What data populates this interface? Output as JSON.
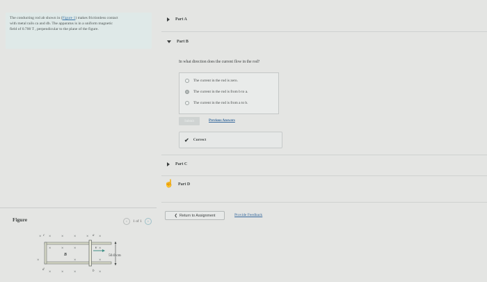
{
  "problem": {
    "line1": "The conducting rod ab shown in (",
    "figure_link": "Figure 1",
    "line1_end": ") makes frictionless contact",
    "line2": "with metal rails ca and db. The apparatus is in a uniform magnetic",
    "line3": "field of 0.700 T , perpendicular to the plane of the figure."
  },
  "figure_panel": {
    "title": "Figure",
    "pager": "1 of 1",
    "prev_arrow": "‹",
    "next_arrow": "›"
  },
  "figure": {
    "b_label": "B",
    "v_label": "v",
    "dimension": "50.0 cm",
    "corner_labels": [
      "c",
      "a",
      "d",
      "b"
    ],
    "field_symbol": "×"
  },
  "parts": {
    "part_a": "Part A",
    "part_b": "Part B",
    "part_c": "Part C",
    "part_d": "Part D"
  },
  "part_b": {
    "question": "In what direction does the current flow in the rod?",
    "options": [
      "The current in the rod is zero.",
      "The current in the rod is from b to a.",
      "The current in the rod is from a to b."
    ],
    "selected_index": 1,
    "submit_label": "Submit",
    "previous_answers": "Previous Answers",
    "result": "Correct"
  },
  "footer": {
    "return_label": "Return to Assignment",
    "return_arrow": "❮",
    "feedback_label": "Provide Feedback"
  }
}
